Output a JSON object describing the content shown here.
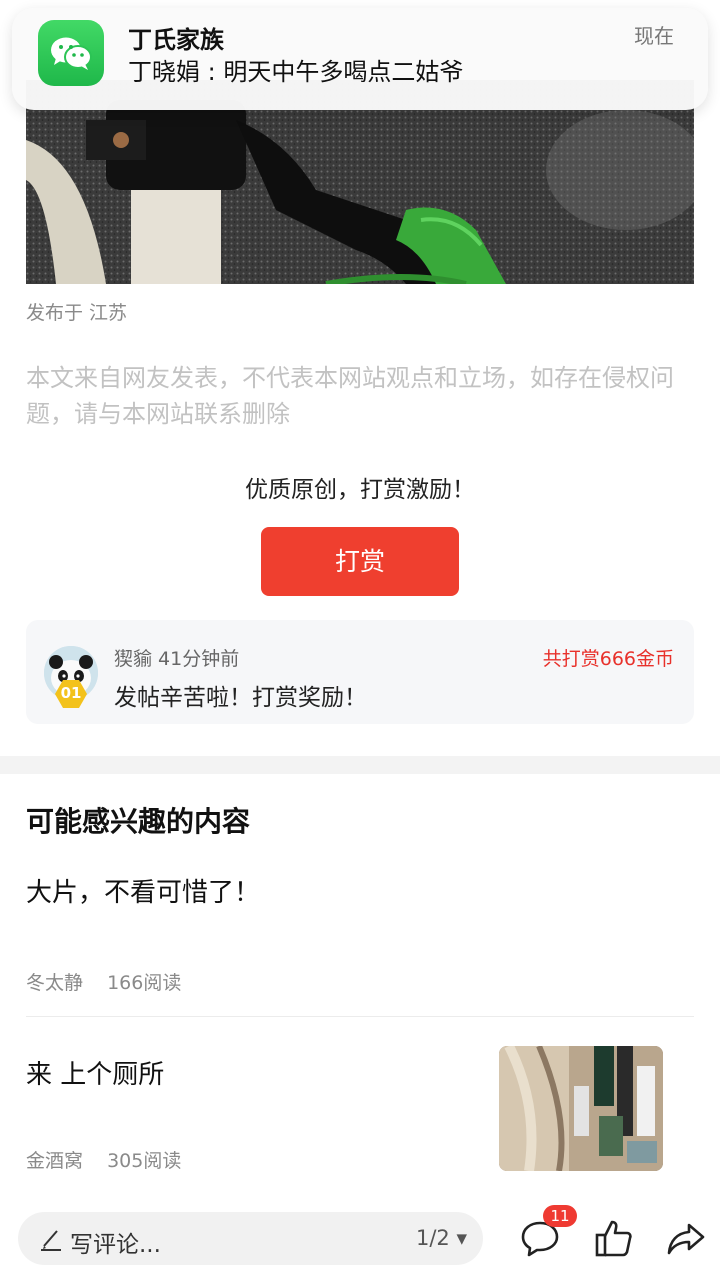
{
  "notification": {
    "app_icon": "wechat-icon",
    "title": "丁氏家族",
    "message": "丁晓娟 : 明天中午多喝点二姑爷",
    "time": "现在"
  },
  "article": {
    "location": "发布于 江苏",
    "disclaimer": "本文来自网友发表，不代表本网站观点和立场，如存在侵权问题，请与本网站联系删除"
  },
  "reward": {
    "slogan": "优质原创，打赏激励！",
    "button_label": "打赏",
    "latest": {
      "rank": "01",
      "user_time": "猰貐 41分钟前",
      "comment": "发帖辛苦啦！打赏奖励！",
      "total": "共打赏666金币"
    }
  },
  "recommendations": {
    "section_title": "可能感兴趣的内容",
    "items": [
      {
        "title": "大片，不看可惜了！",
        "author": "冬太静",
        "reads": "166阅读"
      },
      {
        "title": "来 上个厕所",
        "author": "金酒窝",
        "reads": "305阅读"
      }
    ]
  },
  "bottom_bar": {
    "comment_placeholder": "写评论...",
    "page_indicator": "1/2 ▾",
    "comment_count": "11",
    "icons": [
      "pen-icon",
      "comment-icon",
      "like-icon",
      "share-icon"
    ]
  },
  "colors": {
    "accent_red": "#ef3f2f",
    "reward_total_red": "#e8312b",
    "wechat_green": "#1fb84a"
  }
}
